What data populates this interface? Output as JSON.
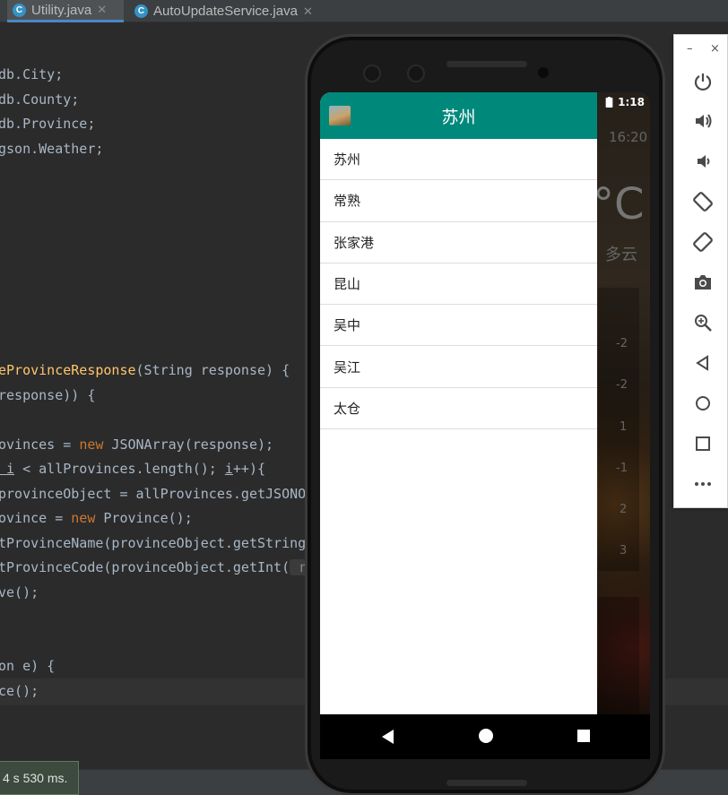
{
  "tabs": [
    {
      "label": "Utility.java",
      "icon": "C",
      "active": true
    },
    {
      "label": "AutoUpdateService.java",
      "icon": "C",
      "active": false
    }
  ],
  "code": {
    "l1": "db.City;",
    "l2": "db.County;",
    "l3": "db.Province;",
    "l4": "gson.Weather;",
    "l5_fn": "eProvinceResponse",
    "l5_rest": "(String response) {",
    "l6": "response)) {",
    "l7_a": "ovinces = ",
    "l7_kw": "new",
    "l7_b": " JSONArray(response);",
    "l8_a": " i",
    "l8_b": " < allProvinces.length(); ",
    "l8_c": "i",
    "l8_d": "++){",
    "l9": "provinceObject = allProvinces.getJSONO",
    "l10_a": "ovince = ",
    "l10_kw": "new",
    "l10_b": " Province();",
    "l11": "tProvinceName(provinceObject.getString",
    "l12_a": "tProvinceCode(provinceObject.getInt(",
    "l12_hint": " n",
    "l13": "ve();",
    "l14": "on e) {",
    "l15": "ce();"
  },
  "build_toast": "4 s 530 ms.",
  "phone": {
    "status_time": "1:18",
    "weather": {
      "update_time": "16:20",
      "temp_unit": "°C",
      "condition": "多云",
      "forecast_vals": [
        "-2",
        "-2",
        "1",
        "-1",
        "2",
        "3"
      ]
    },
    "app_title": "苏州",
    "counties": [
      "苏州",
      "常熟",
      "张家港",
      "昆山",
      "吴中",
      "吴江",
      "太仓"
    ]
  },
  "emulator_toolbar": {
    "minimize": "–",
    "close": "×",
    "buttons": [
      "power-icon",
      "volume-up-icon",
      "volume-down-icon",
      "rotate-left-icon",
      "rotate-right-icon",
      "camera-icon",
      "zoom-icon",
      "back-icon",
      "home-icon",
      "overview-icon",
      "more-icon"
    ]
  }
}
